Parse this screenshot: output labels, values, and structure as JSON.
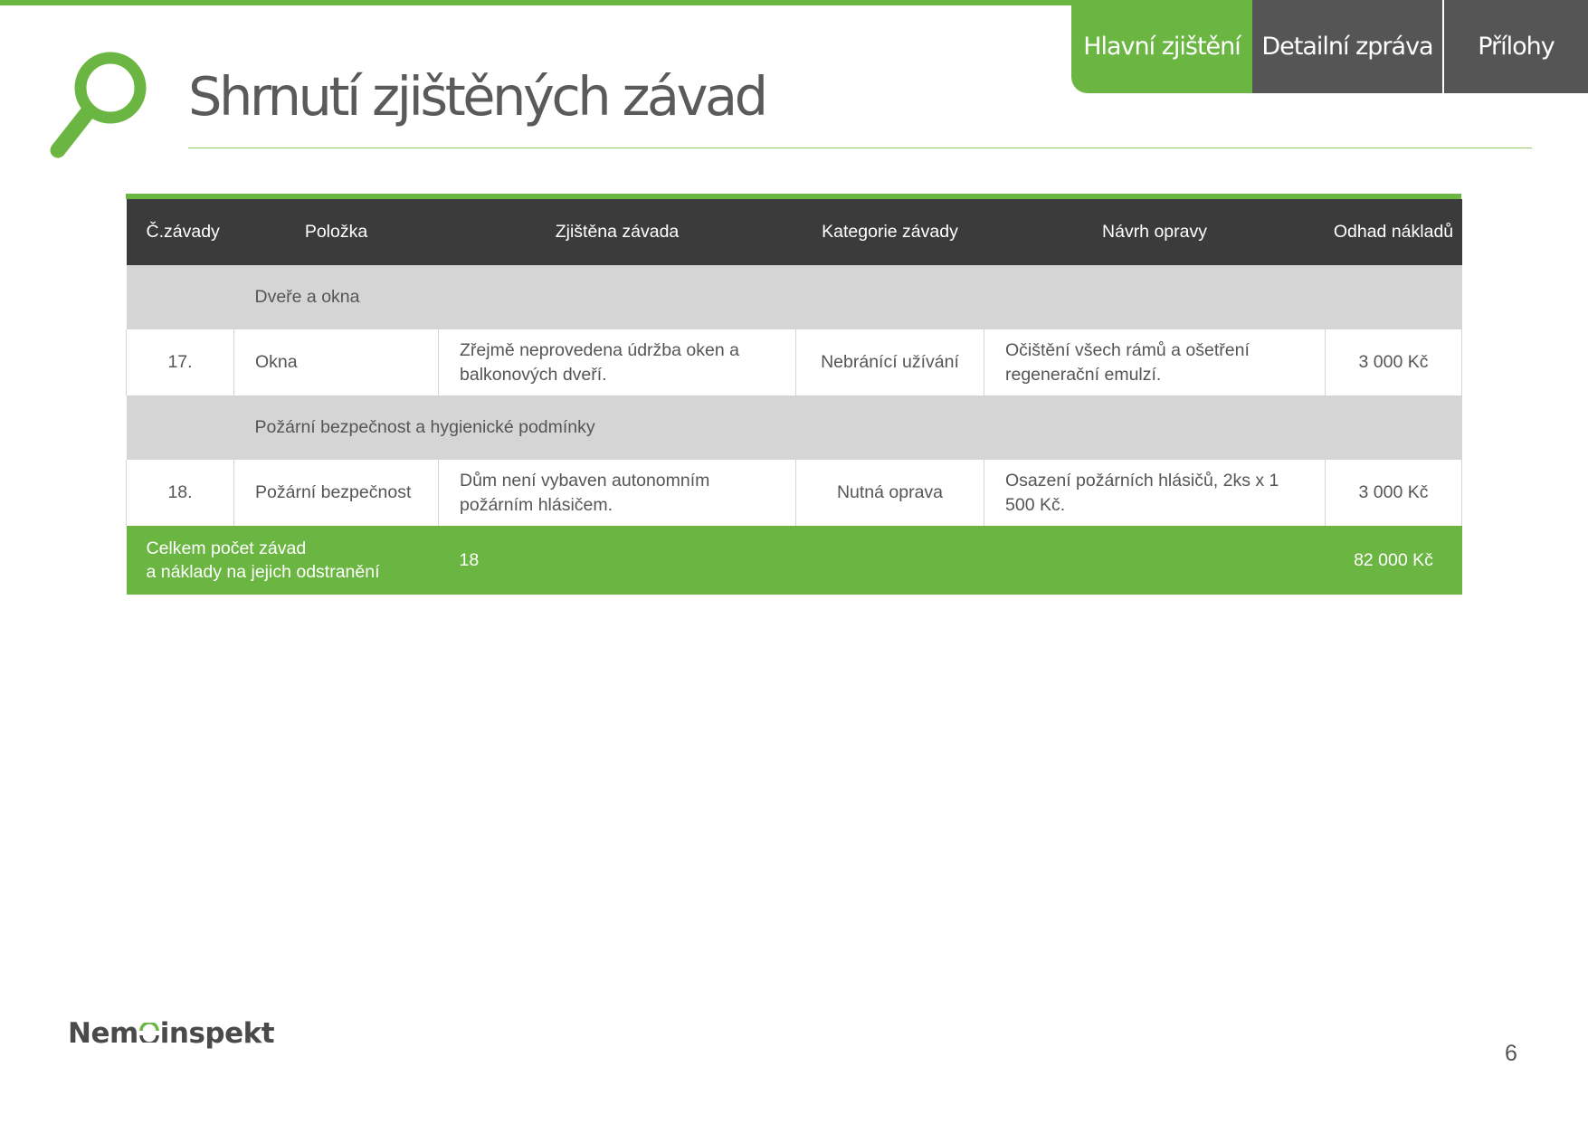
{
  "colors": {
    "accent_green": "#6bb643",
    "dark_header": "#3b3b3b",
    "tab_gray": "#555555",
    "group_row": "#d5d5d5",
    "text_gray": "#555555"
  },
  "tabs": [
    {
      "label": "Hlavní zjištění",
      "active": true
    },
    {
      "label": "Detailní zpráva",
      "active": false
    },
    {
      "label": "Přílohy",
      "active": false
    }
  ],
  "header": {
    "title": "Shrnutí zjištěných závad",
    "icon": "magnifier-icon"
  },
  "table": {
    "columns": [
      "Č.závady",
      "Položka",
      "Zjištěna závada",
      "Kategorie závady",
      "Návrh opravy",
      "Odhad nákladů"
    ],
    "groups": [
      {
        "label": "Dveře a okna",
        "rows": [
          {
            "number": "17.",
            "item": "Okna",
            "defect": "Zřejmě neprovedena údržba oken a balkonových dveří.",
            "category": "Nebránící užívání",
            "repair": "Očištění všech rámů a ošetření regenerační emulzí.",
            "cost": "3 000 Kč"
          }
        ]
      },
      {
        "label": "Požární bezpečnost a hygienické podmínky",
        "rows": [
          {
            "number": "18.",
            "item": "Požární bezpečnost",
            "defect": "Dům není vybaven autonomním požárním hlásičem.",
            "category": "Nutná oprava",
            "repair": "Osazení požárních hlásičů, 2ks x 1 500 Kč.",
            "cost": "3 000 Kč"
          }
        ]
      }
    ],
    "total": {
      "label_line1": "Celkem počet závad",
      "label_line2": "a náklady na jejich odstranění",
      "count": "18",
      "cost": "82 000 Kč"
    }
  },
  "footer": {
    "logo_text_before": "Nem",
    "logo_text_after": "inspekt",
    "page_number": "6"
  }
}
